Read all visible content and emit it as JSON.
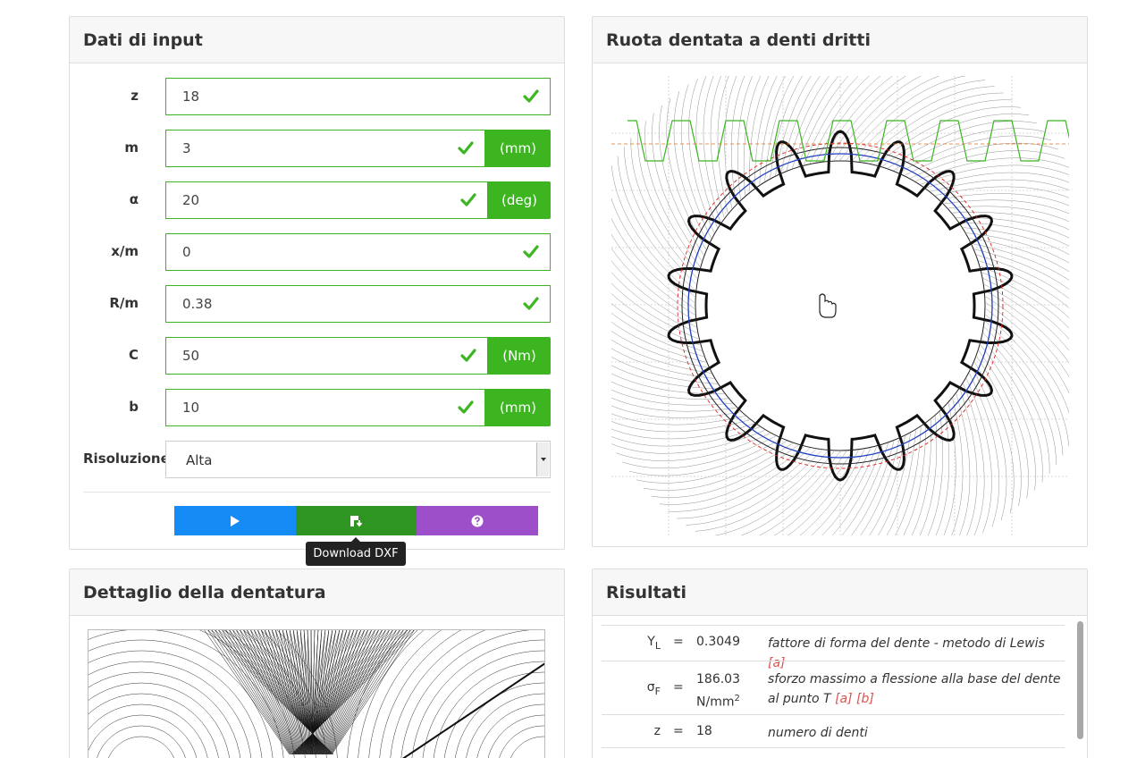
{
  "input_panel": {
    "title": "Dati di input",
    "fields": [
      {
        "label": "z",
        "value": "18",
        "unit": ""
      },
      {
        "label": "m",
        "value": "3",
        "unit": "(mm)"
      },
      {
        "label": "α",
        "value": "20",
        "unit": "(deg)"
      },
      {
        "label": "x/m",
        "value": "0",
        "unit": ""
      },
      {
        "label": "R/m",
        "value": "0.38",
        "unit": ""
      },
      {
        "label": "C",
        "value": "50",
        "unit": "(Nm)"
      },
      {
        "label": "b",
        "value": "10",
        "unit": "(mm)"
      }
    ],
    "resolution": {
      "label": "Risoluzione",
      "value": "Alta"
    },
    "buttons": {
      "run_icon": "play-icon",
      "download_icon": "download-dxf-icon",
      "help_icon": "help-icon"
    },
    "tooltip": "Download DXF"
  },
  "gear_panel": {
    "title": "Ruota dentata a denti dritti"
  },
  "detail_panel": {
    "title": "Dettaglio della dentatura"
  },
  "results_panel": {
    "title": "Risultati",
    "rows": [
      {
        "sym": "Y",
        "sub": "L",
        "eq": "=",
        "value": "0.3049",
        "desc": "fattore di forma del dente - metodo di Lewis",
        "refs": "[a]"
      },
      {
        "sym": "σ",
        "sub": "F",
        "eq": "=",
        "value": "186.03",
        "value_unit": "N/mm",
        "sup": "2",
        "desc": "sforzo massimo a flessione alla base del dente al punto T",
        "refs": "[a] [b]"
      },
      {
        "sym": "z",
        "sub": "",
        "eq": "=",
        "value": "18",
        "desc": "numero di denti",
        "refs": ""
      }
    ]
  },
  "colors": {
    "success": "#3cb521",
    "run": "#158cf5",
    "download": "#2f9522",
    "help": "#9d4fc9",
    "tooltip": "#222222"
  }
}
